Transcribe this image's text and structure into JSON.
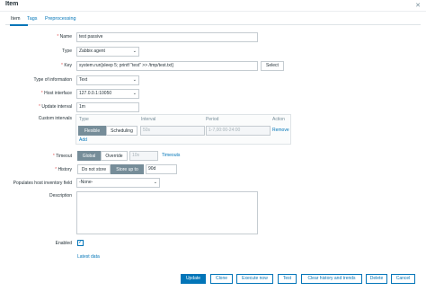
{
  "window": {
    "title": "Item",
    "close_icon": "close-icon"
  },
  "tabs": [
    {
      "label": "Item",
      "active": true
    },
    {
      "label": "Tags",
      "active": false
    },
    {
      "label": "Preprocessing",
      "active": false
    }
  ],
  "form": {
    "name": {
      "label": "Name",
      "required": true,
      "value": "test passive"
    },
    "type": {
      "label": "Type",
      "value": "Zabbix agent"
    },
    "key": {
      "label": "Key",
      "required": true,
      "value": "system.run[sleep 5; printf \"test\" >> /tmp/test.txt]",
      "select_label": "Select"
    },
    "type_of_information": {
      "label": "Type of information",
      "value": "Text"
    },
    "host_interface": {
      "label": "Host interface",
      "required": true,
      "value": "127.0.0.1:10050"
    },
    "update_interval": {
      "label": "Update interval",
      "required": true,
      "value": "1m"
    },
    "custom_intervals": {
      "label": "Custom intervals",
      "columns": {
        "type": "Type",
        "interval": "Interval",
        "period": "Period",
        "action": "Action"
      },
      "row": {
        "flexible": "Flexible",
        "scheduling": "Scheduling",
        "interval_placeholder": "50s",
        "period_placeholder": "1-7,00:00-24:00",
        "remove": "Remove"
      },
      "add": "Add"
    },
    "timeout": {
      "label": "Timeout",
      "required": true,
      "global": "Global",
      "override": "Override",
      "value": "10s",
      "link": "Timeouts"
    },
    "history": {
      "label": "History",
      "required": true,
      "do_not_store": "Do not store",
      "store_up_to": "Store up to",
      "value": "90d"
    },
    "inventory_field": {
      "label": "Populates host inventory field",
      "value": "-None-"
    },
    "description": {
      "label": "Description",
      "value": ""
    },
    "enabled": {
      "label": "Enabled",
      "checked": true
    },
    "latest_data": "Latest data"
  },
  "footer": {
    "update": "Update",
    "clone": "Clone",
    "execute_now": "Execute now",
    "test": "Test",
    "clear_history": "Clear history and trends",
    "delete": "Delete",
    "cancel": "Cancel"
  },
  "colors": {
    "accent": "#0275b8",
    "required": "#e45959",
    "segment_on": "#768d99"
  }
}
